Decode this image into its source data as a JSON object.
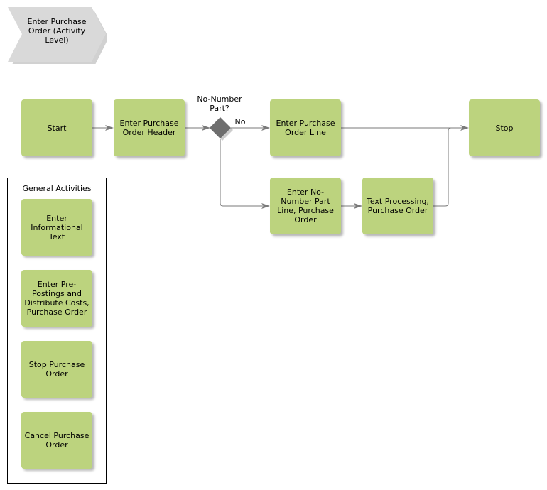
{
  "header": {
    "title": "Enter Purchase Order (Activity Level)"
  },
  "diagram": {
    "nodes": {
      "start": "Start",
      "enter_header": "Enter Purchase Order Header",
      "decision": "No-Number Part?",
      "enter_line": "Enter Purchase Order Line",
      "stop": "Stop",
      "enter_no_number": "Enter No-Number Part Line, Purchase Order",
      "text_processing": "Text Processing, Purchase Order"
    },
    "edge_labels": {
      "decision_no": "No"
    },
    "colors": {
      "activity_fill": "#bcd37e",
      "decision_fill": "#6e6e6e",
      "chevron_fill": "#d9d9d9",
      "edge_stroke": "#7a7a7a"
    }
  },
  "general_activities": {
    "title": "General Activities",
    "items": [
      "Enter Informational Text",
      "Enter Pre-Postings and Distribute Costs, Purchase Order",
      "Stop Purchase Order",
      "Cancel Purchase Order"
    ]
  }
}
